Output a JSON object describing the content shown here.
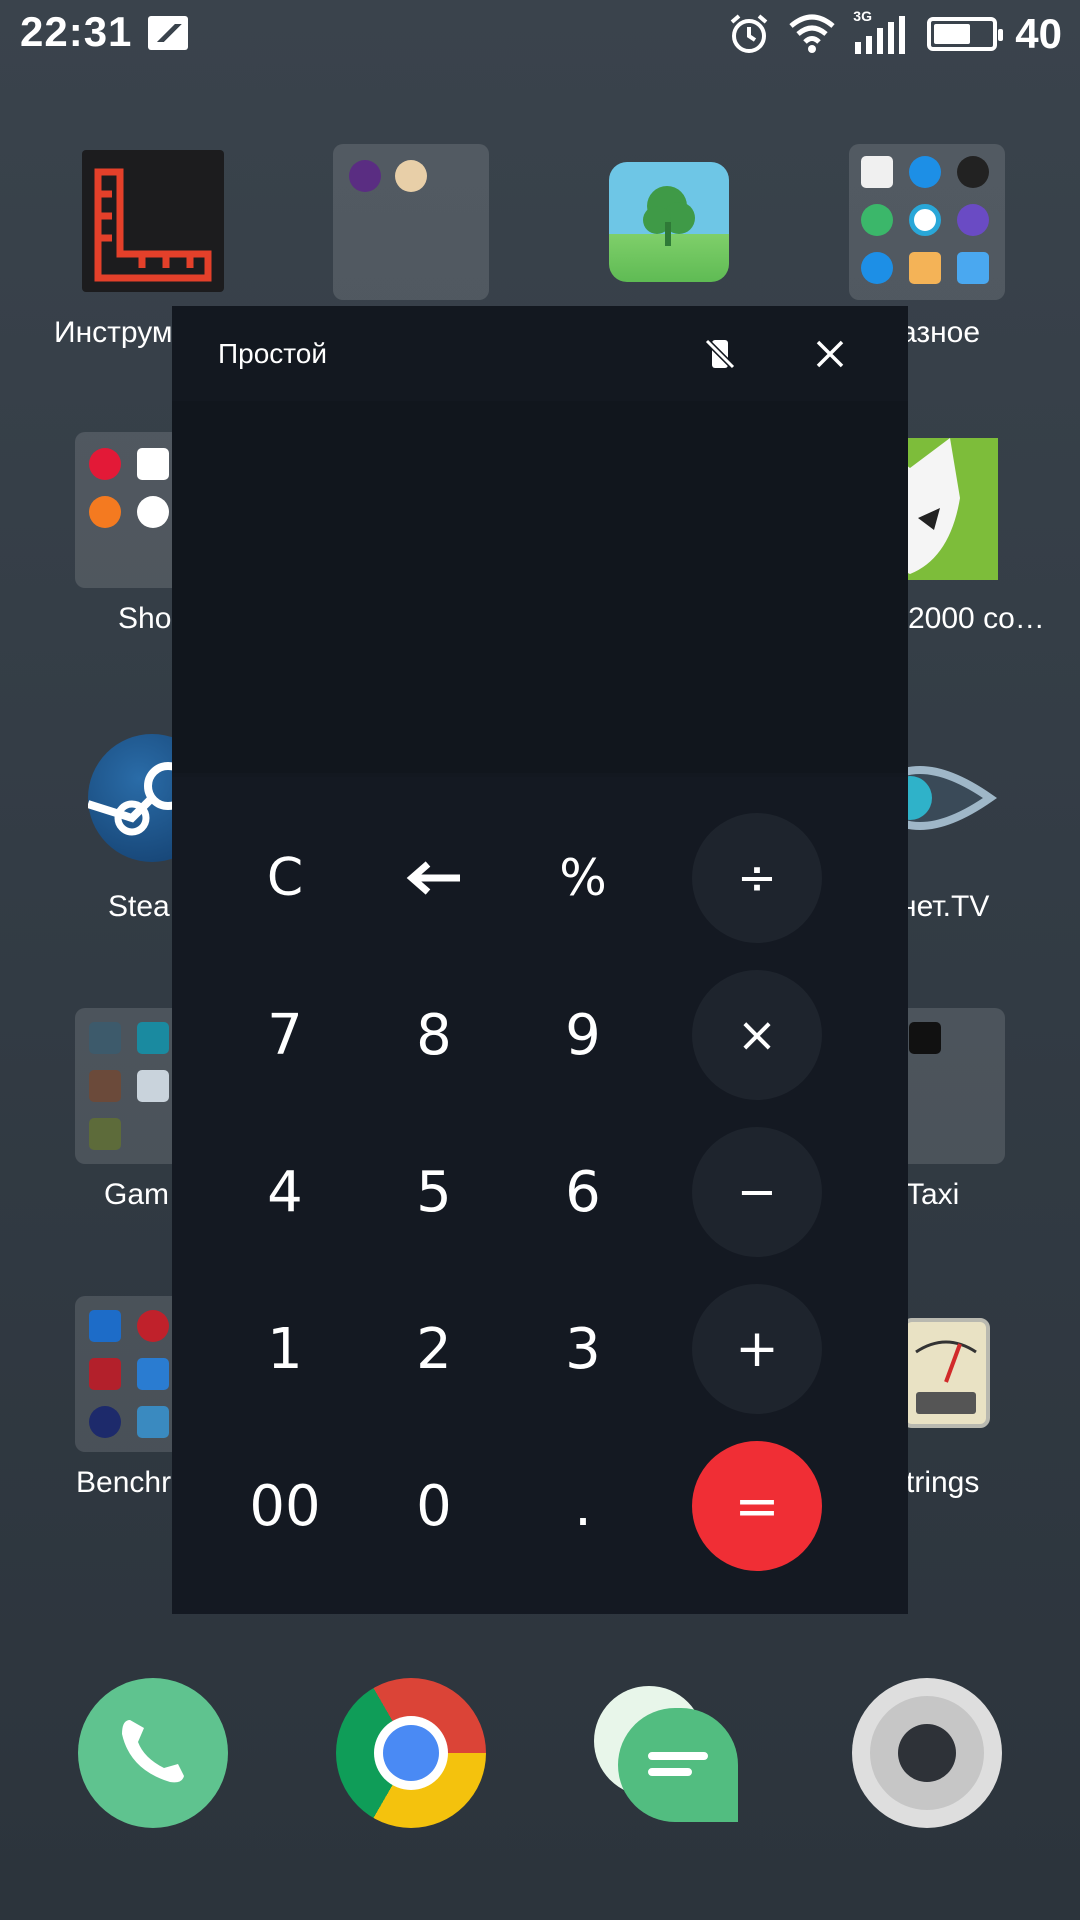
{
  "status_bar": {
    "time": "22:31",
    "network": "3G",
    "battery": "40"
  },
  "home_apps": [
    {
      "label": "Инструм"
    },
    {
      "label": ""
    },
    {
      "label": ""
    },
    {
      "label": "азное"
    },
    {
      "label": "Sho"
    },
    {
      "label": "2000 co…"
    },
    {
      "label": "Stea"
    },
    {
      "label": "нет.TV"
    },
    {
      "label": "Gam"
    },
    {
      "label": "Taxi"
    },
    {
      "label": "Benchr"
    },
    {
      "label": "trings"
    }
  ],
  "calculator": {
    "title": "Простой",
    "keys": {
      "clear": "C",
      "percent": "%",
      "divide": "÷",
      "k7": "7",
      "k8": "8",
      "k9": "9",
      "multiply": "×",
      "k4": "4",
      "k5": "5",
      "k6": "6",
      "minus": "−",
      "k1": "1",
      "k2": "2",
      "k3": "3",
      "plus": "+",
      "k00": "00",
      "k0": "0",
      "dot": ".",
      "equals": "="
    }
  },
  "colors": {
    "accent_equals": "#f02e35",
    "window_bg": "#131820",
    "op_bg": "#1e242d"
  }
}
